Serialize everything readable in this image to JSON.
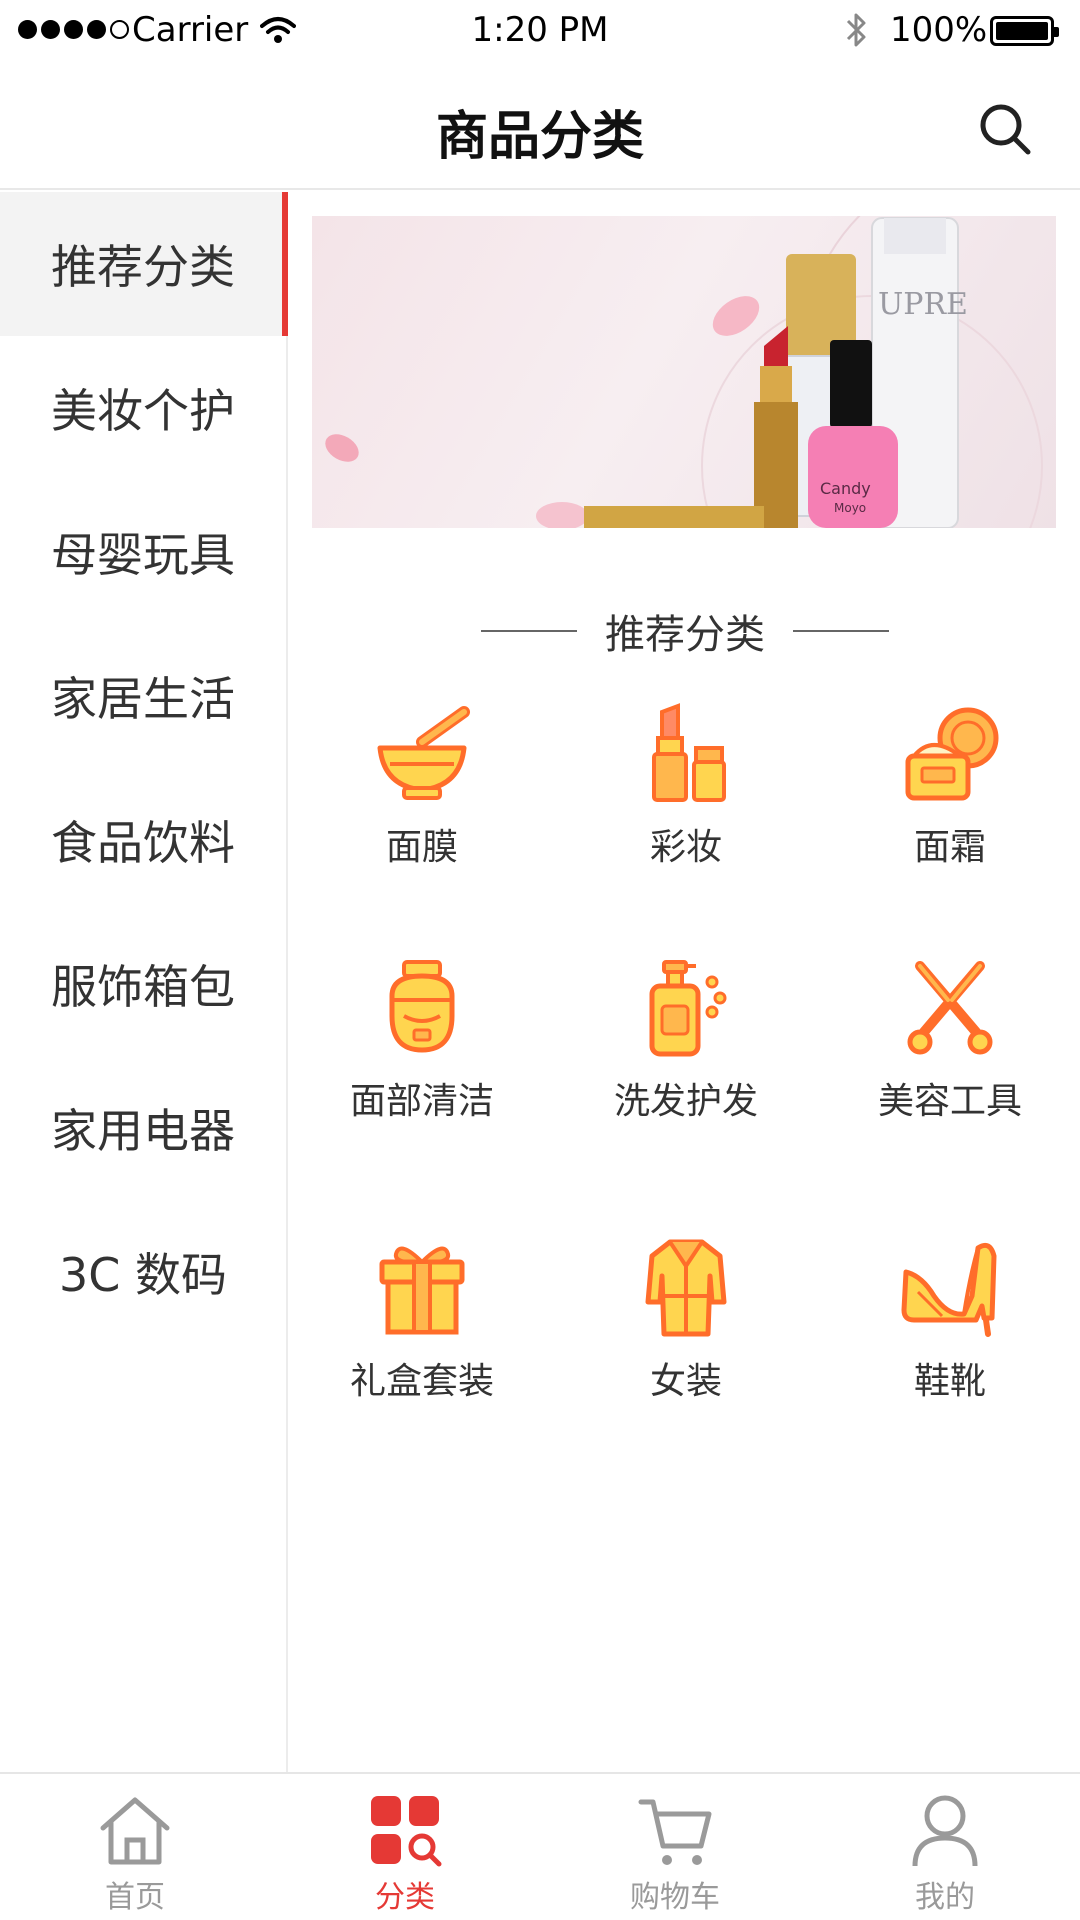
{
  "status_bar": {
    "carrier": "Carrier",
    "time": "1:20 PM",
    "battery": "100%"
  },
  "nav": {
    "title": "商品分类"
  },
  "sidebar": {
    "items": [
      {
        "label": "推荐分类"
      },
      {
        "label": "美妆个护"
      },
      {
        "label": "母婴玩具"
      },
      {
        "label": "家居生活"
      },
      {
        "label": "食品饮料"
      },
      {
        "label": "服饰箱包"
      },
      {
        "label": "家用电器"
      },
      {
        "label": "3C 数码"
      }
    ]
  },
  "main": {
    "section_title": "推荐分类",
    "banner": {
      "bottle_text": "UPRE",
      "polish_text_1": "Candy",
      "polish_text_2": "Moyo"
    },
    "categories": [
      {
        "label": "面膜",
        "icon": "mortar-bowl-icon"
      },
      {
        "label": "彩妆",
        "icon": "lipstick-icon"
      },
      {
        "label": "面霜",
        "icon": "cream-jar-icon"
      },
      {
        "label": "面部清洁",
        "icon": "face-cleanser-icon"
      },
      {
        "label": "洗发护发",
        "icon": "shampoo-bottle-icon"
      },
      {
        "label": "美容工具",
        "icon": "scissors-icon"
      },
      {
        "label": "礼盒套装",
        "icon": "gift-box-icon"
      },
      {
        "label": "女装",
        "icon": "coat-icon"
      },
      {
        "label": "鞋靴",
        "icon": "high-heel-icon"
      }
    ]
  },
  "tab_bar": {
    "tabs": [
      {
        "label": "首页",
        "icon": "home-icon"
      },
      {
        "label": "分类",
        "icon": "category-icon"
      },
      {
        "label": "购物车",
        "icon": "cart-icon"
      },
      {
        "label": "我的",
        "icon": "user-icon"
      }
    ],
    "active_color": "#e53935",
    "inactive_color": "#9a9a9a"
  },
  "colors": {
    "accent": "#e53935",
    "icon_fill": "#ffd54f",
    "icon_stroke": "#ff6d2a"
  }
}
